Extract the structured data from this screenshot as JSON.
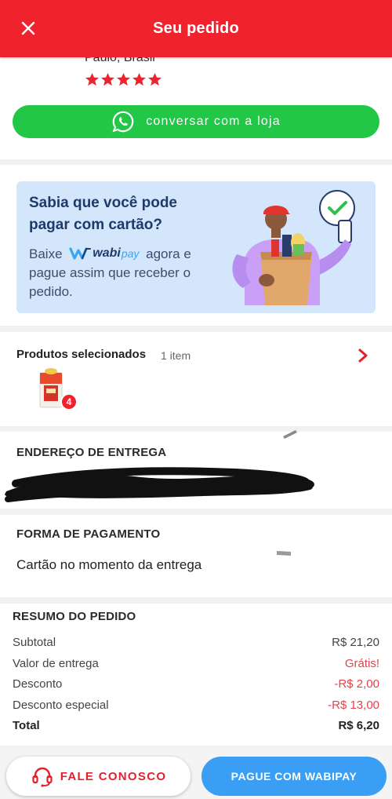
{
  "header": {
    "title": "Seu pedido",
    "close_icon": "close-icon"
  },
  "store": {
    "location": "Paulo, Brasil",
    "rating_stars": 5,
    "whatsapp_label": "conversar com a loja"
  },
  "promo": {
    "headline": "Sabia que você pode pagar com cartão?",
    "body_prefix": "Baixe",
    "logo_wabi": "wabi",
    "logo_pay": "pay",
    "body_suffix": "agora e pague assim que receber o pedido."
  },
  "products": {
    "title": "Produtos selecionados",
    "count_label": "1 item",
    "item_quantity": "4"
  },
  "address": {
    "title": "ENDEREÇO DE ENTREGA"
  },
  "payment": {
    "title": "FORMA DE PAGAMENTO",
    "method": "Cartão no momento da entrega"
  },
  "summary": {
    "title": "RESUMO DO PEDIDO",
    "rows": [
      {
        "label": "Subtotal",
        "value": "R$ 21,20"
      },
      {
        "label": "Valor de entrega",
        "value": "Grátis!"
      },
      {
        "label": "Desconto",
        "value": "-R$ 2,00"
      },
      {
        "label": "Desconto especial",
        "value": "-R$ 13,00"
      }
    ],
    "total_label": "Total",
    "total_value": "R$ 6,20"
  },
  "actions": {
    "contact_label": "FALE CONOSCO",
    "pay_label": "PAGUE COM WABIPAY"
  },
  "colors": {
    "brand_red": "#f0222e",
    "whatsapp_green": "#22c747",
    "pay_blue": "#3a9ef5",
    "promo_bg": "#d4e6fb",
    "discount_red": "#e3434b"
  }
}
